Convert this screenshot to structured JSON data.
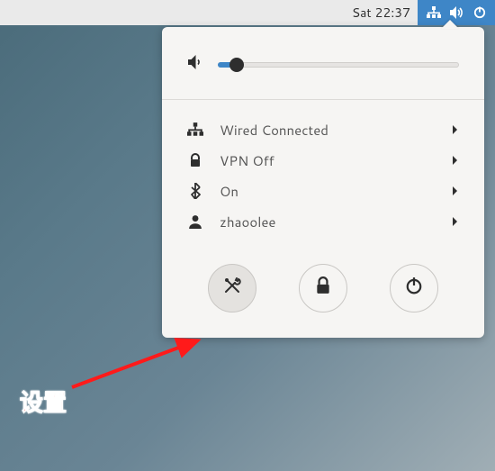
{
  "topbar": {
    "clock": "Sat 22:37"
  },
  "volume": {
    "percent": 8
  },
  "menu": {
    "network": {
      "label": "Wired Connected"
    },
    "vpn": {
      "label": "VPN Off"
    },
    "bluetooth": {
      "label": "On"
    },
    "user": {
      "label": "zhaoolee"
    }
  },
  "annotation": {
    "label": "设置"
  }
}
